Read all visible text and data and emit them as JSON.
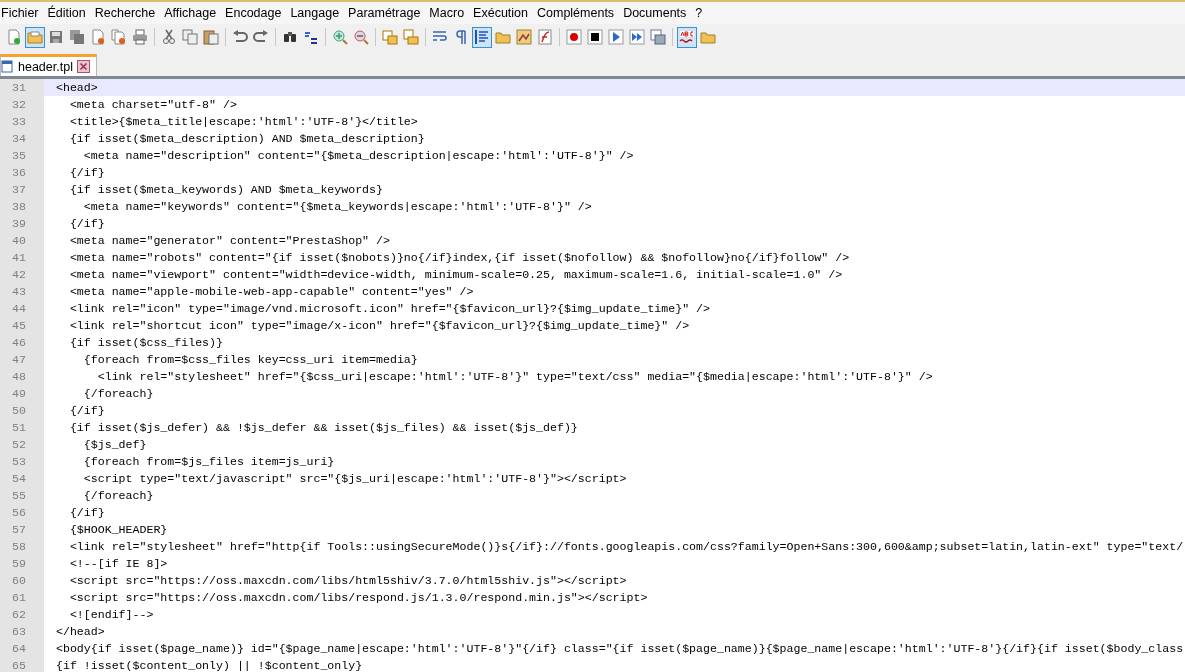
{
  "menu": [
    "Fichier",
    "Édition",
    "Recherche",
    "Affichage",
    "Encodage",
    "Langage",
    "Paramétrage",
    "Macro",
    "Exécution",
    "Compléments",
    "Documents",
    "?"
  ],
  "toolbar": [
    [
      {
        "kind": "new",
        "pressed": false
      },
      {
        "kind": "open",
        "pressed": true
      },
      {
        "kind": "save",
        "pressed": false
      },
      {
        "kind": "save-all",
        "pressed": false
      },
      {
        "kind": "close",
        "pressed": false
      },
      {
        "kind": "close-all",
        "pressed": false
      },
      {
        "kind": "print",
        "pressed": false
      }
    ],
    [
      {
        "kind": "cut",
        "pressed": false
      },
      {
        "kind": "copy",
        "pressed": false
      },
      {
        "kind": "paste",
        "pressed": false
      }
    ],
    [
      {
        "kind": "undo",
        "pressed": false
      },
      {
        "kind": "redo",
        "pressed": false
      }
    ],
    [
      {
        "kind": "find",
        "pressed": false
      },
      {
        "kind": "replace",
        "pressed": false
      }
    ],
    [
      {
        "kind": "zoom-in",
        "pressed": false
      },
      {
        "kind": "zoom-out",
        "pressed": false
      }
    ],
    [
      {
        "kind": "sync-vertical",
        "pressed": false
      },
      {
        "kind": "sync-horizontal",
        "pressed": false
      }
    ],
    [
      {
        "kind": "wrap",
        "pressed": false
      },
      {
        "kind": "pilcrow",
        "pressed": false
      },
      {
        "kind": "indent-guide",
        "pressed": true
      },
      {
        "kind": "folder",
        "pressed": false
      },
      {
        "kind": "map",
        "pressed": false
      },
      {
        "kind": "function",
        "pressed": false
      }
    ],
    [
      {
        "kind": "record",
        "pressed": false
      },
      {
        "kind": "stop",
        "pressed": false
      },
      {
        "kind": "play",
        "pressed": false
      },
      {
        "kind": "play-multiple",
        "pressed": false
      },
      {
        "kind": "save-macro",
        "pressed": false
      }
    ],
    [
      {
        "kind": "spellcheck",
        "pressed": true
      },
      {
        "kind": "folder",
        "pressed": false
      }
    ]
  ],
  "tabs": [
    {
      "label": "header.tpl",
      "selected": true
    }
  ],
  "editor": {
    "lines": [
      {
        "number": "31",
        "text": "<head>",
        "current": true
      },
      {
        "number": "32",
        "text": "  <meta charset=\"utf-8\" />",
        "current": false
      },
      {
        "number": "33",
        "text": "  <title>{$meta_title|escape:'html':'UTF-8'}</title>",
        "current": false
      },
      {
        "number": "34",
        "text": "  {if isset($meta_description) AND $meta_description}",
        "current": false
      },
      {
        "number": "35",
        "text": "    <meta name=\"description\" content=\"{$meta_description|escape:'html':'UTF-8'}\" />",
        "current": false
      },
      {
        "number": "36",
        "text": "  {/if}",
        "current": false
      },
      {
        "number": "37",
        "text": "  {if isset($meta_keywords) AND $meta_keywords}",
        "current": false
      },
      {
        "number": "38",
        "text": "    <meta name=\"keywords\" content=\"{$meta_keywords|escape:'html':'UTF-8'}\" />",
        "current": false
      },
      {
        "number": "39",
        "text": "  {/if}",
        "current": false
      },
      {
        "number": "40",
        "text": "  <meta name=\"generator\" content=\"PrestaShop\" />",
        "current": false
      },
      {
        "number": "41",
        "text": "  <meta name=\"robots\" content=\"{if isset($nobots)}no{/if}index,{if isset($nofollow) && $nofollow}no{/if}follow\" />",
        "current": false
      },
      {
        "number": "42",
        "text": "  <meta name=\"viewport\" content=\"width=device-width, minimum-scale=0.25, maximum-scale=1.6, initial-scale=1.0\" />",
        "current": false
      },
      {
        "number": "43",
        "text": "  <meta name=\"apple-mobile-web-app-capable\" content=\"yes\" />",
        "current": false
      },
      {
        "number": "44",
        "text": "  <link rel=\"icon\" type=\"image/vnd.microsoft.icon\" href=\"{$favicon_url}?{$img_update_time}\" />",
        "current": false
      },
      {
        "number": "45",
        "text": "  <link rel=\"shortcut icon\" type=\"image/x-icon\" href=\"{$favicon_url}?{$img_update_time}\" />",
        "current": false
      },
      {
        "number": "46",
        "text": "  {if isset($css_files)}",
        "current": false
      },
      {
        "number": "47",
        "text": "    {foreach from=$css_files key=css_uri item=media}",
        "current": false
      },
      {
        "number": "48",
        "text": "      <link rel=\"stylesheet\" href=\"{$css_uri|escape:'html':'UTF-8'}\" type=\"text/css\" media=\"{$media|escape:'html':'UTF-8'}\" />",
        "current": false
      },
      {
        "number": "49",
        "text": "    {/foreach}",
        "current": false
      },
      {
        "number": "50",
        "text": "  {/if}",
        "current": false
      },
      {
        "number": "51",
        "text": "  {if isset($js_defer) && !$js_defer && isset($js_files) && isset($js_def)}",
        "current": false
      },
      {
        "number": "52",
        "text": "    {$js_def}",
        "current": false
      },
      {
        "number": "53",
        "text": "    {foreach from=$js_files item=js_uri}",
        "current": false
      },
      {
        "number": "54",
        "text": "    <script type=\"text/javascript\" src=\"{$js_uri|escape:'html':'UTF-8'}\"></script>",
        "current": false
      },
      {
        "number": "55",
        "text": "    {/foreach}",
        "current": false
      },
      {
        "number": "56",
        "text": "  {/if}",
        "current": false
      },
      {
        "number": "57",
        "text": "  {$HOOK_HEADER}",
        "current": false
      },
      {
        "number": "58",
        "text": "  <link rel=\"stylesheet\" href=\"http{if Tools::usingSecureMode()}s{/if}://fonts.googleapis.com/css?family=Open+Sans:300,600&amp;subset=latin,latin-ext\" type=\"text/",
        "current": false
      },
      {
        "number": "59",
        "text": "  <!--[if IE 8]>",
        "current": false
      },
      {
        "number": "60",
        "text": "  <script src=\"https://oss.maxcdn.com/libs/html5shiv/3.7.0/html5shiv.js\"></script>",
        "current": false
      },
      {
        "number": "61",
        "text": "  <script src=\"https://oss.maxcdn.com/libs/respond.js/1.3.0/respond.min.js\"></script>",
        "current": false
      },
      {
        "number": "62",
        "text": "  <![endif]-->",
        "current": false
      },
      {
        "number": "63",
        "text": "</head>",
        "current": false
      },
      {
        "number": "64",
        "text": "<body{if isset($page_name)} id=\"{$page_name|escape:'html':'UTF-8'}\"{/if} class=\"{if isset($page_name)}{$page_name|escape:'html':'UTF-8'}{/if}{if isset($body_class",
        "current": false
      },
      {
        "number": "65",
        "text": "{if !isset($content_only) || !$content_only}",
        "current": false
      }
    ]
  }
}
